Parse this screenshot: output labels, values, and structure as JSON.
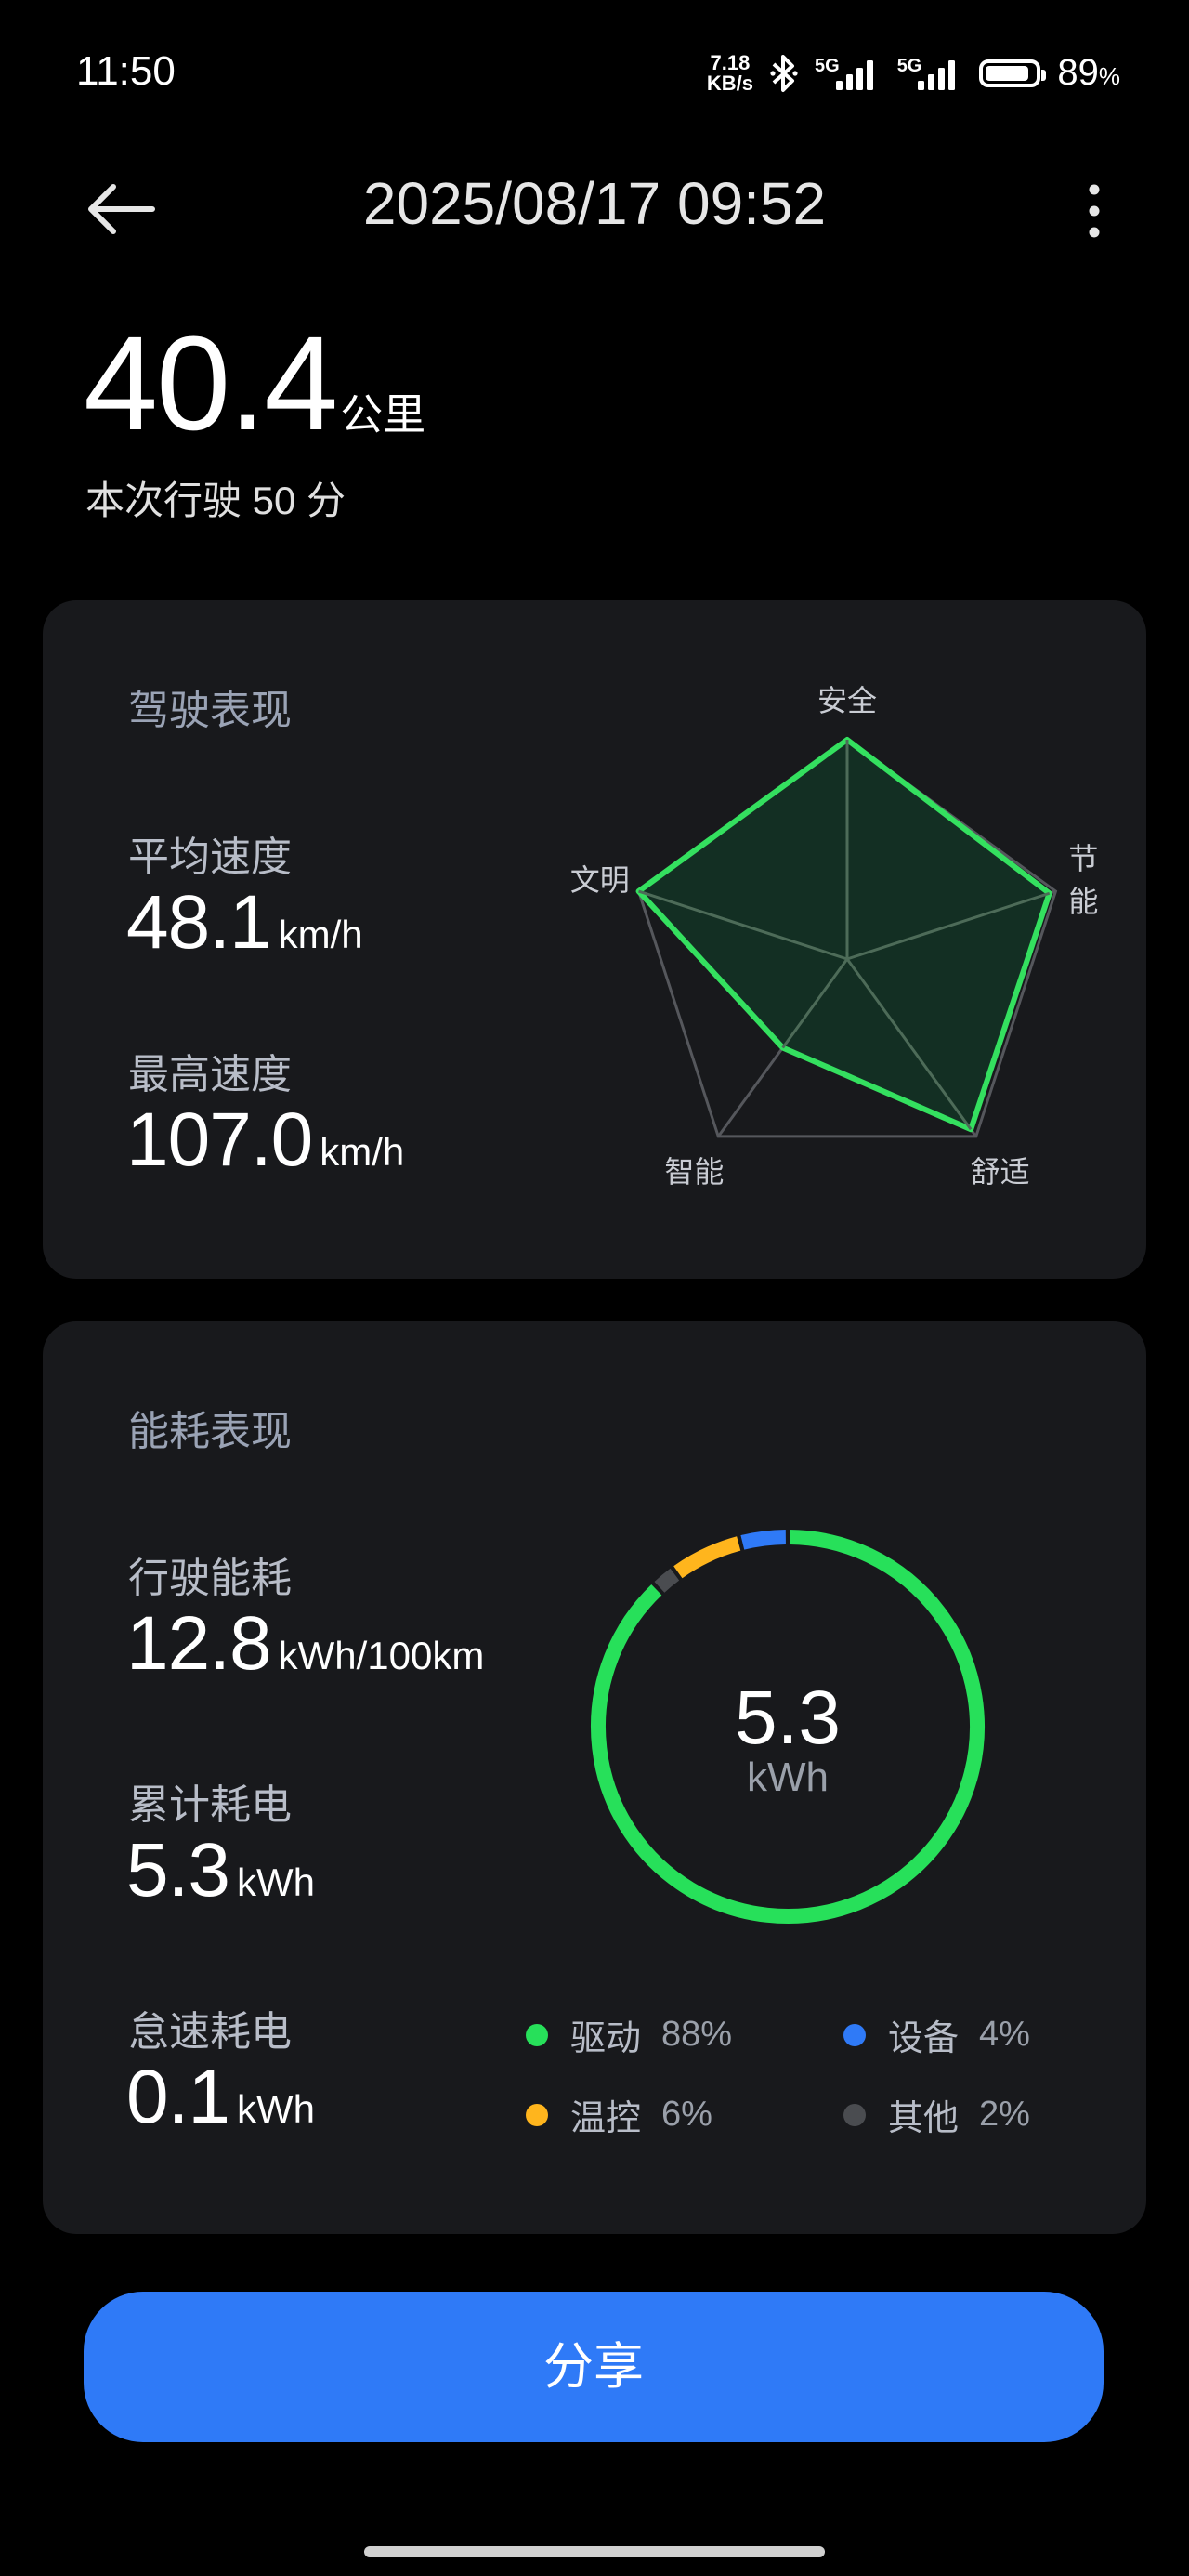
{
  "status_bar": {
    "time": "11:50",
    "net_speed_value": "7.18",
    "net_speed_unit": "KB/s",
    "network_1": "5G",
    "network_2": "5G",
    "battery_percent": "89",
    "battery_symbol": "%",
    "battery_level": 0.89
  },
  "header": {
    "title": "2025/08/17 09:52"
  },
  "trip": {
    "distance_value": "40.4",
    "distance_unit": "公里",
    "duration_text": "本次行驶 50 分"
  },
  "driving_card": {
    "title": "驾驶表现",
    "avg_speed_label": "平均速度",
    "avg_speed_value": "48.1",
    "avg_speed_unit": "km/h",
    "max_speed_label": "最高速度",
    "max_speed_value": "107.0",
    "max_speed_unit": "km/h",
    "radar": {
      "axes": [
        "安全",
        "节能",
        "舒适",
        "智能",
        "文明"
      ],
      "scores": [
        1.0,
        0.97,
        0.96,
        0.5,
        1.0
      ],
      "line_color": "#34e05f",
      "fill_color": "#143124"
    }
  },
  "energy_card": {
    "title": "能耗表现",
    "driving_consumption_label": "行驶能耗",
    "driving_consumption_value": "12.8",
    "driving_consumption_unit": "kWh/100km",
    "total_label": "累计耗电",
    "total_value": "5.3",
    "total_unit": "kWh",
    "idle_label": "怠速耗电",
    "idle_value": "0.1",
    "idle_unit": "kWh",
    "donut": {
      "center_value": "5.3",
      "center_unit": "kWh"
    },
    "legend": [
      {
        "name": "驱动",
        "pct": "88%",
        "value": 88,
        "color": "#27e05a"
      },
      {
        "name": "设备",
        "pct": "4%",
        "value": 4,
        "color": "#2f7af7"
      },
      {
        "name": "温控",
        "pct": "6%",
        "value": 6,
        "color": "#ffb51d"
      },
      {
        "name": "其他",
        "pct": "2%",
        "value": 2,
        "color": "#4a4c50"
      }
    ]
  },
  "share_button": {
    "label": "分享",
    "color": "#2f7af7"
  }
}
